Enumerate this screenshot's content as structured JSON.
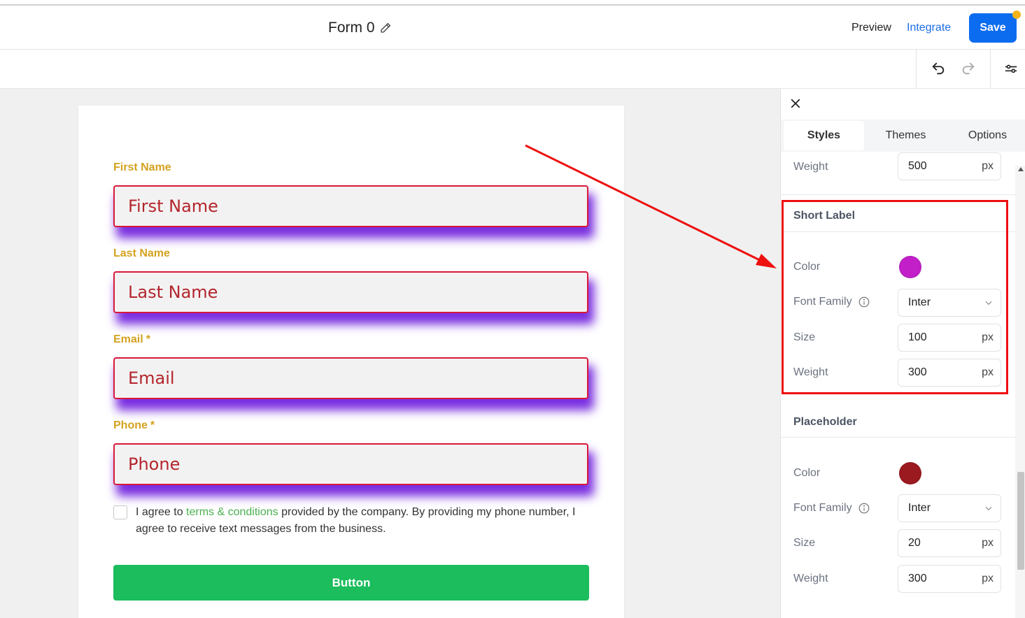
{
  "header": {
    "form_title": "Form 0",
    "preview_label": "Preview",
    "integrate_label": "Integrate",
    "save_label": "Save"
  },
  "form": {
    "fields": [
      {
        "label": "First Name",
        "placeholder": "First Name",
        "required": false
      },
      {
        "label": "Last Name",
        "placeholder": "Last Name",
        "required": false
      },
      {
        "label": "Email",
        "placeholder": "Email",
        "required": true
      },
      {
        "label": "Phone",
        "placeholder": "Phone",
        "required": true
      }
    ],
    "required_marker": "*",
    "consent": {
      "prefix": "I agree to ",
      "link": "terms & conditions",
      "suffix": " provided by the company. By providing my phone number, I agree to receive text messages from the business."
    },
    "button_label": "Button"
  },
  "panel": {
    "tabs": [
      "Styles",
      "Themes",
      "Options"
    ],
    "active_tab": "Styles",
    "top_weight": {
      "label": "Weight",
      "value": "500",
      "unit": "px"
    },
    "short_label": {
      "title": "Short Label",
      "color_label": "Color",
      "color": "#c21fc9",
      "font_family_label": "Font Family",
      "font_family": "Inter",
      "size_label": "Size",
      "size": "100",
      "size_unit": "px",
      "weight_label": "Weight",
      "weight": "300",
      "weight_unit": "px"
    },
    "placeholder": {
      "title": "Placeholder",
      "color_label": "Color",
      "color": "#9b1a1f",
      "font_family_label": "Font Family",
      "font_family": "Inter",
      "size_label": "Size",
      "size": "20",
      "size_unit": "px",
      "weight_label": "Weight",
      "weight": "300",
      "weight_unit": "px"
    }
  },
  "colors": {
    "accent_blue": "#0b6cf0",
    "label_gold": "#d4a21f",
    "input_border": "#d9183b",
    "input_shadow": "#7a2fe0",
    "button_green": "#1bbd5c",
    "annotation_red": "#ee0f0f"
  }
}
